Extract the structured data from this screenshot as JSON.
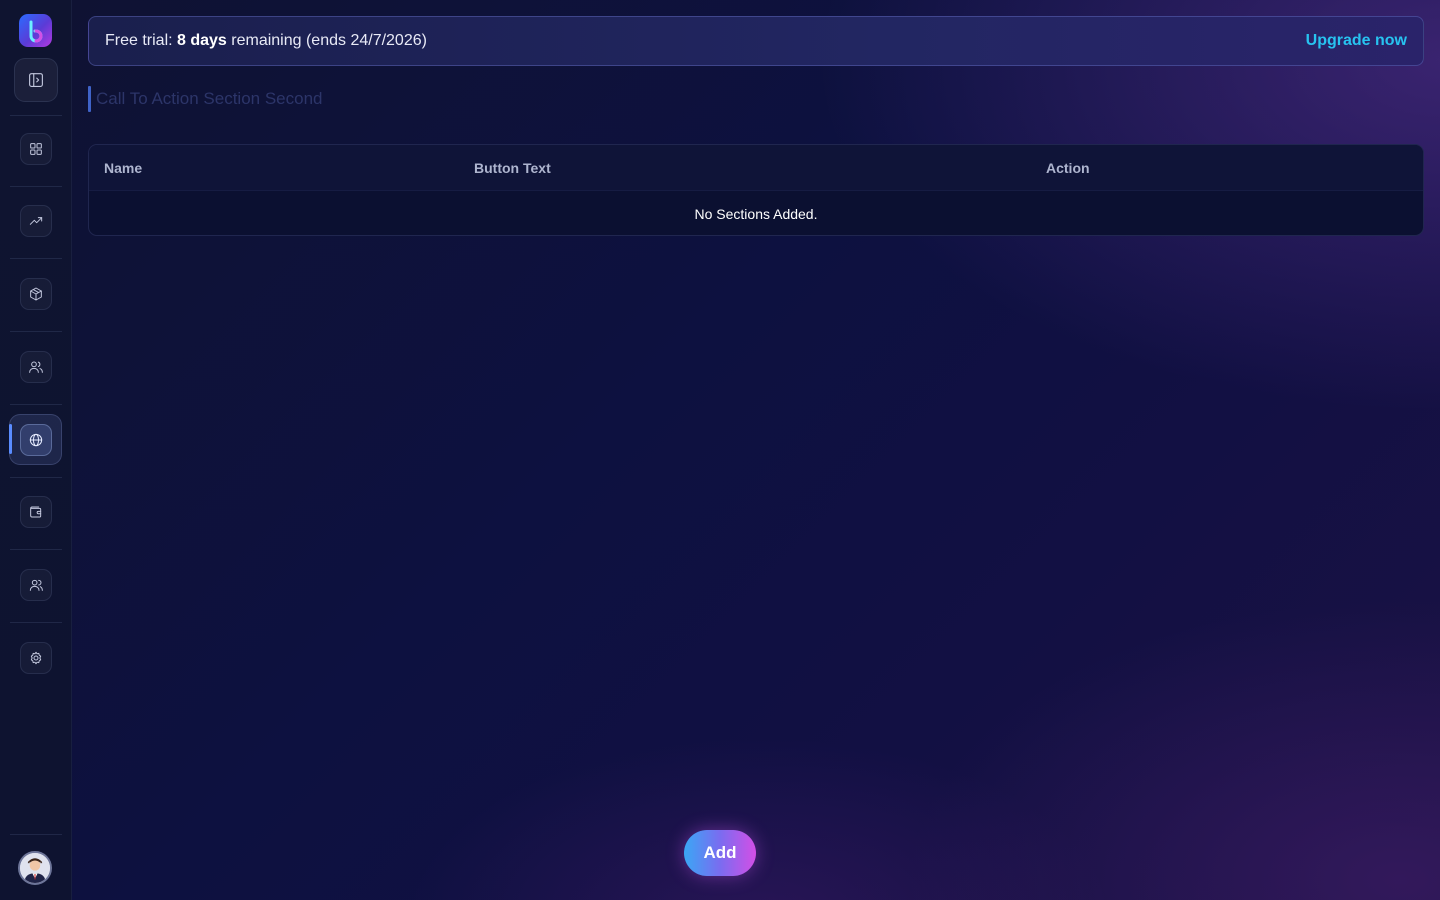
{
  "sidebar": {
    "logo": "brand-logo",
    "items": [
      {
        "icon": "sidebar-toggle-icon"
      },
      {
        "icon": "dashboard-grid-icon"
      },
      {
        "icon": "analytics-trend-icon"
      },
      {
        "icon": "package-box-icon"
      },
      {
        "icon": "customers-icon"
      },
      {
        "icon": "globe-icon",
        "active": true
      },
      {
        "icon": "wallet-icon"
      },
      {
        "icon": "team-icon"
      },
      {
        "icon": "gear-icon"
      }
    ],
    "accent_color": "#5a8cff"
  },
  "trial_banner": {
    "prefix": "Free trial: ",
    "days": "8 days",
    "suffix": " remaining (ends 24/7/2026)",
    "upgrade_label": "Upgrade now",
    "upgrade_color": "#27c3f0"
  },
  "page": {
    "title": "Call To Action Section Second"
  },
  "table": {
    "columns": [
      "Name",
      "Button Text",
      "Action"
    ],
    "empty_message": "No Sections Added."
  },
  "actions": {
    "add_label": "Add"
  }
}
